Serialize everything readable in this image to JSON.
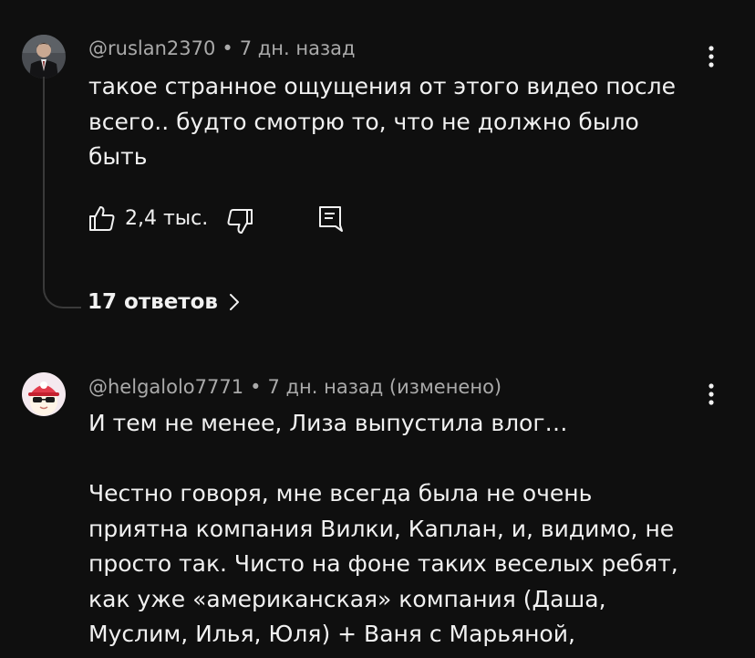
{
  "colors": {
    "background": "#0f0f0f",
    "text_primary": "#f1f1f1",
    "text_secondary": "#aaaaaa",
    "thread_line": "#3a3a3a"
  },
  "comments": [
    {
      "author": "@ruslan2370",
      "separator": "•",
      "time": "7 дн. назад",
      "text": "такое странное ощущения от этого видео после\nвсего.. будто смотрю то, что не должно было\nбыть",
      "likes": "2,4 тыс.",
      "icons": {
        "like": "thumb-up-icon",
        "dislike": "thumb-down-icon",
        "reply": "reply-icon",
        "more": "more-vertical-icon"
      },
      "replies_label": "17 ответов"
    },
    {
      "author": "@helgalolo7771",
      "separator": "•",
      "time": "7 дн. назад (изменено)",
      "text": "И тем не менее, Лиза выпустила влог…\n\nЧестно говоря, мне всегда была не очень\nприятна компания Вилки, Каплан, и, видимо, не\nпросто так. Чисто на фоне таких веселых ребят,\nкак уже «американская» компания (Даша,\nМуслим, Илья, Юля) + Ваня с Марьяной,",
      "icons": {
        "more": "more-vertical-icon"
      }
    }
  ]
}
